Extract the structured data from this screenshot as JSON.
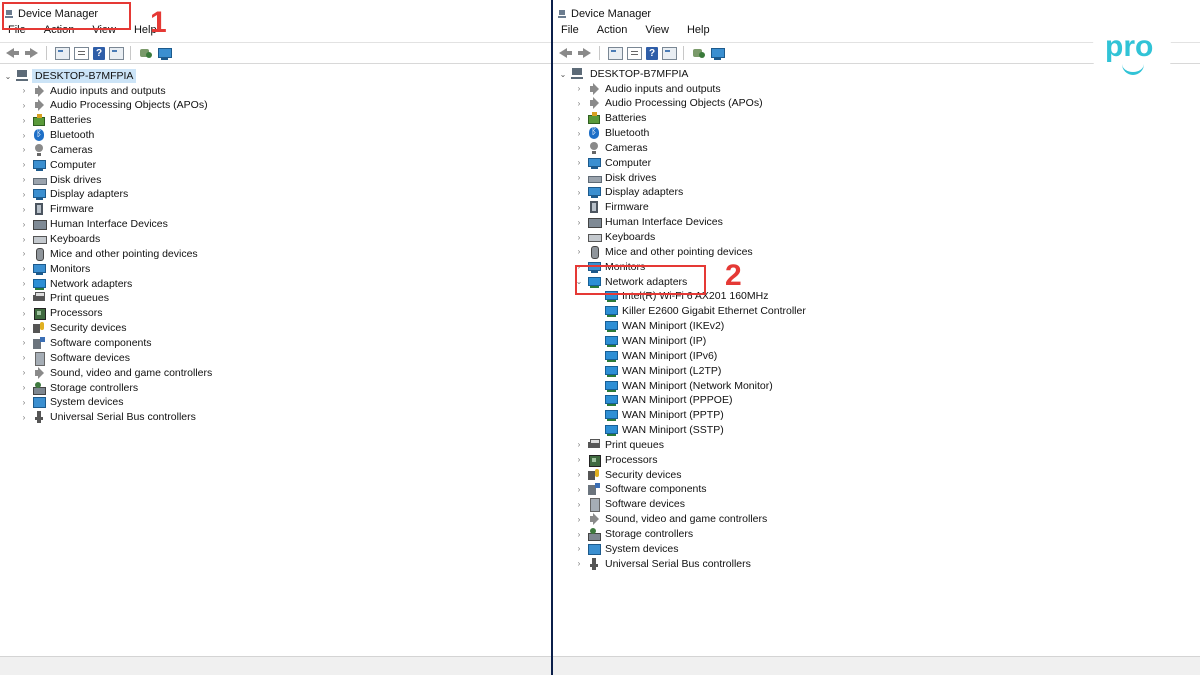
{
  "window": {
    "title": "Device Manager"
  },
  "menu": [
    "File",
    "Action",
    "View",
    "Help"
  ],
  "root": "DESKTOP-B7MFPIA",
  "left_categories": [
    {
      "label": "Audio inputs and outputs",
      "icon": "speaker-icon"
    },
    {
      "label": "Audio Processing Objects (APOs)",
      "icon": "speaker-icon"
    },
    {
      "label": "Batteries",
      "icon": "battery-icon"
    },
    {
      "label": "Bluetooth",
      "icon": "bluetooth-icon"
    },
    {
      "label": "Cameras",
      "icon": "camera-icon"
    },
    {
      "label": "Computer",
      "icon": "monitor-icon"
    },
    {
      "label": "Disk drives",
      "icon": "disk-drive-icon"
    },
    {
      "label": "Display adapters",
      "icon": "display-adapter-icon"
    },
    {
      "label": "Firmware",
      "icon": "firmware-icon"
    },
    {
      "label": "Human Interface Devices",
      "icon": "hid-icon"
    },
    {
      "label": "Keyboards",
      "icon": "keyboard-icon"
    },
    {
      "label": "Mice and other pointing devices",
      "icon": "mouse-icon"
    },
    {
      "label": "Monitors",
      "icon": "monitor-icon"
    },
    {
      "label": "Network adapters",
      "icon": "network-adapter-icon"
    },
    {
      "label": "Print queues",
      "icon": "printer-icon"
    },
    {
      "label": "Processors",
      "icon": "processor-icon"
    },
    {
      "label": "Security devices",
      "icon": "security-device-icon"
    },
    {
      "label": "Software components",
      "icon": "software-component-icon"
    },
    {
      "label": "Software devices",
      "icon": "software-device-icon"
    },
    {
      "label": "Sound, video and game controllers",
      "icon": "sound-icon"
    },
    {
      "label": "Storage controllers",
      "icon": "storage-controller-icon"
    },
    {
      "label": "System devices",
      "icon": "system-device-icon"
    },
    {
      "label": "Universal Serial Bus controllers",
      "icon": "usb-icon"
    }
  ],
  "network_adapters": [
    "Intel(R) Wi-Fi 6 AX201 160MHz",
    "Killer E2600 Gigabit Ethernet Controller",
    "WAN Miniport (IKEv2)",
    "WAN Miniport (IP)",
    "WAN Miniport (IPv6)",
    "WAN Miniport (L2TP)",
    "WAN Miniport (Network Monitor)",
    "WAN Miniport (PPPOE)",
    "WAN Miniport (PPTP)",
    "WAN Miniport (SSTP)"
  ],
  "annotations": {
    "step1": "1",
    "step2": "2"
  },
  "logo": {
    "text": "pro"
  },
  "colors": {
    "annotation": "#e53935",
    "selection": "#cce4f7",
    "logo": "#31c3d6"
  }
}
